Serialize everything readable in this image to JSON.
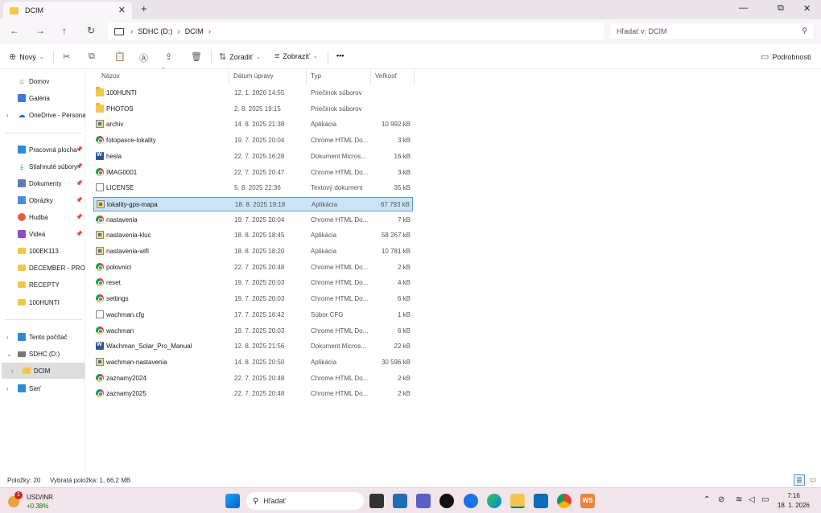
{
  "tab": {
    "title": "DCIM",
    "close": "✕",
    "new": "+"
  },
  "window_controls": {
    "minimize": "—",
    "maximize": "⧉",
    "close": "✕"
  },
  "nav": {
    "back": "←",
    "forward": "→",
    "up": "↑",
    "refresh": "↻"
  },
  "breadcrumbs": [
    "SDHC (D:)",
    "DCIM"
  ],
  "search": {
    "placeholder": "Hľadať v: DCIM"
  },
  "commands": {
    "new": "Nový",
    "sort": "Zoradiť",
    "view": "Zobraziť",
    "more": "•••",
    "details": "Podrobnosti"
  },
  "sidebar": {
    "items": [
      {
        "label": "Domov",
        "icon": "home-icon"
      },
      {
        "label": "Galéria",
        "icon": "gallery-icon"
      },
      {
        "label": "OneDrive - Persona",
        "icon": "cloud-icon"
      },
      {
        "label": "Pracovná plocha",
        "icon": "desktop-icon"
      },
      {
        "label": "Stiahnuté súbory",
        "icon": "download-icon"
      },
      {
        "label": "Dokumenty",
        "icon": "documents-icon"
      },
      {
        "label": "Obrázky",
        "icon": "pictures-icon"
      },
      {
        "label": "Hudba",
        "icon": "music-icon"
      },
      {
        "label": "Videá",
        "icon": "videos-icon"
      },
      {
        "label": "100EK113",
        "icon": "folder-icon"
      },
      {
        "label": "DECEMBER - PROSI",
        "icon": "folder-icon"
      },
      {
        "label": "RECEPTY",
        "icon": "folder-icon"
      },
      {
        "label": "100HUNTI",
        "icon": "folder-icon"
      },
      {
        "label": "Tento počítač",
        "icon": "pc-icon"
      },
      {
        "label": "SDHC (D:)",
        "icon": "drive-icon"
      },
      {
        "label": "DCIM",
        "icon": "folder-icon"
      },
      {
        "label": "Sieť",
        "icon": "network-icon"
      }
    ]
  },
  "columns": {
    "name": "Názov",
    "date": "Dátum úpravy",
    "type": "Typ",
    "size": "Veľkosť"
  },
  "files": [
    {
      "name": "100HUNTI",
      "date": "12. 1. 2026 14:55",
      "type": "Priečinok súborov",
      "size": "",
      "icon": "folder"
    },
    {
      "name": "PHOTOS",
      "date": "2. 8. 2025 19:15",
      "type": "Priečinok súborov",
      "size": "",
      "icon": "folder"
    },
    {
      "name": "archiv",
      "date": "14. 8. 2025 21:38",
      "type": "Aplikácia",
      "size": "10 992 kB",
      "icon": "app"
    },
    {
      "name": "fotopasce-lokality",
      "date": "19. 7. 2025 20:04",
      "type": "Chrome HTML Do...",
      "size": "3 kB",
      "icon": "chrome"
    },
    {
      "name": "hesla",
      "date": "22. 7. 2025 16:28",
      "type": "Dokument Micros...",
      "size": "16 kB",
      "icon": "word"
    },
    {
      "name": "IMAG0001",
      "date": "22. 7. 2025 20:47",
      "type": "Chrome HTML Do...",
      "size": "3 kB",
      "icon": "chrome"
    },
    {
      "name": "LICENSE",
      "date": "5. 8. 2025 22:36",
      "type": "Textový dokument",
      "size": "35 kB",
      "icon": "doc"
    },
    {
      "name": "lokality-gps-mapa",
      "date": "18. 8. 2025 19:18",
      "type": "Aplikácia",
      "size": "67 793 kB",
      "icon": "app",
      "selected": true
    },
    {
      "name": "nastavenia",
      "date": "19. 7. 2025 20:04",
      "type": "Chrome HTML Do...",
      "size": "7 kB",
      "icon": "chrome"
    },
    {
      "name": "nastavenia-kluc",
      "date": "18. 8. 2025 18:45",
      "type": "Aplikácia",
      "size": "58 267 kB",
      "icon": "app"
    },
    {
      "name": "nastavenia-wifi",
      "date": "18. 8. 2025 18:20",
      "type": "Aplikácia",
      "size": "10 781 kB",
      "icon": "app"
    },
    {
      "name": "polovnici",
      "date": "22. 7. 2025 20:48",
      "type": "Chrome HTML Do...",
      "size": "2 kB",
      "icon": "chrome"
    },
    {
      "name": "reset",
      "date": "19. 7. 2025 20:03",
      "type": "Chrome HTML Do...",
      "size": "4 kB",
      "icon": "chrome"
    },
    {
      "name": "settings",
      "date": "19. 7. 2025 20:03",
      "type": "Chrome HTML Do...",
      "size": "6 kB",
      "icon": "chrome"
    },
    {
      "name": "wachman.cfg",
      "date": "17. 7. 2025 16:42",
      "type": "Súbor CFG",
      "size": "1 kB",
      "icon": "doc"
    },
    {
      "name": "wachman",
      "date": "19. 7. 2025 20:03",
      "type": "Chrome HTML Do...",
      "size": "6 kB",
      "icon": "chrome"
    },
    {
      "name": "Wachman_Solar_Pro_Manual",
      "date": "12. 8. 2025 21:56",
      "type": "Dokument Micros...",
      "size": "22 kB",
      "icon": "word"
    },
    {
      "name": "wachman-nastavenia",
      "date": "14. 8. 2025 20:50",
      "type": "Aplikácia",
      "size": "30 596 kB",
      "icon": "app"
    },
    {
      "name": "zaznamy2024",
      "date": "22. 7. 2025 20:48",
      "type": "Chrome HTML Do...",
      "size": "2 kB",
      "icon": "chrome"
    },
    {
      "name": "zaznamy2025",
      "date": "22. 7. 2025 20:48",
      "type": "Chrome HTML Do...",
      "size": "2 kB",
      "icon": "chrome"
    }
  ],
  "status": {
    "count": "Položky: 20",
    "selection": "Vybratá položka: 1, 66,2 MB"
  },
  "taskbar": {
    "stock_name": "USD/INR",
    "stock_change": "+0.38%",
    "stock_badge": "1",
    "search_label": "Hľadať",
    "time": "7:16",
    "date": "18. 1. 2026"
  },
  "colors": {
    "accent": "#0067c0",
    "selected_row": "#cce4f7",
    "stock_positive": "#0f7b0f"
  }
}
